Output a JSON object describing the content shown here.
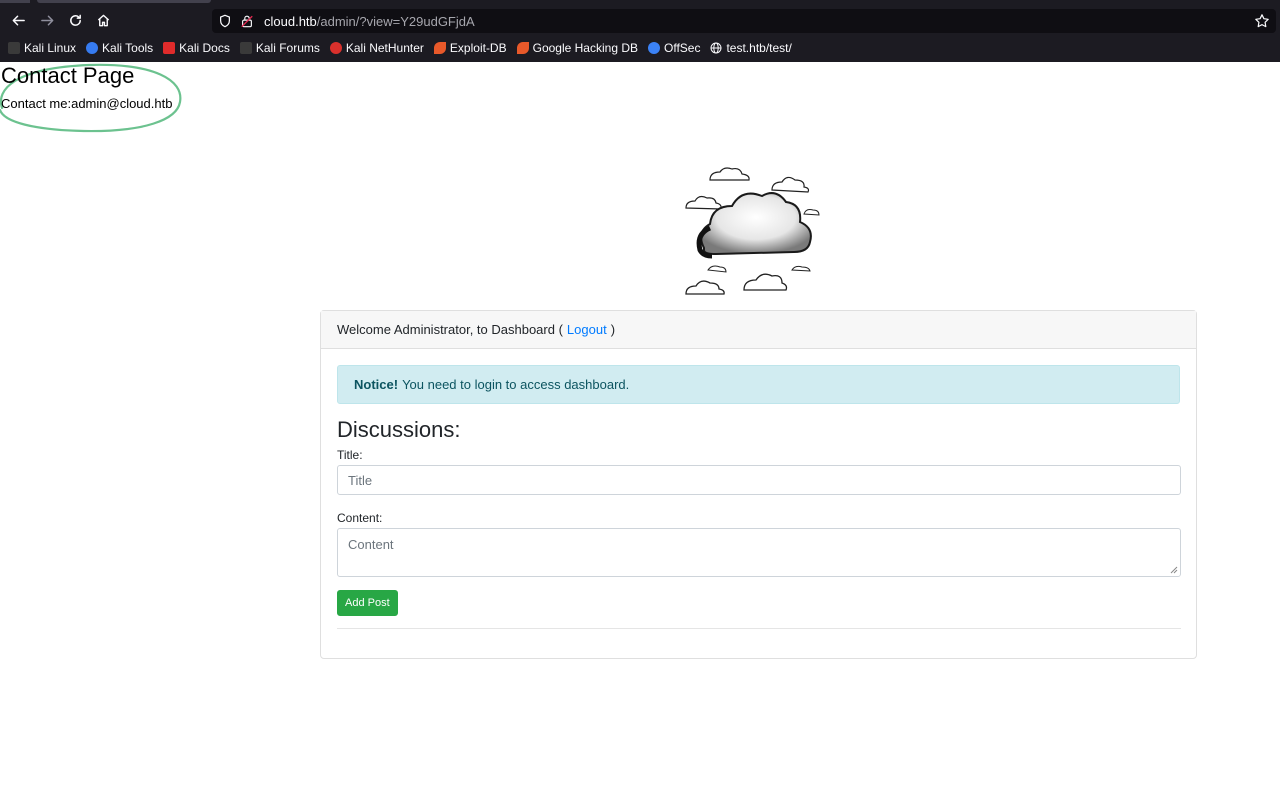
{
  "browser": {
    "url_host": "cloud.htb",
    "url_path": "/admin/?view=Y29udGFjdA",
    "bookmarks": [
      {
        "label": "Kali Linux",
        "icon": "kali-dragon-icon",
        "color": "#2f2f2f"
      },
      {
        "label": "Kali Tools",
        "icon": "kali-tools-icon",
        "color": "#367bf0"
      },
      {
        "label": "Kali Docs",
        "icon": "kali-docs-icon",
        "color": "#e02b2b"
      },
      {
        "label": "Kali Forums",
        "icon": "kali-dragon-icon",
        "color": "#2f2f2f"
      },
      {
        "label": "Kali NetHunter",
        "icon": "nethunter-icon",
        "color": "#d9302c"
      },
      {
        "label": "Exploit-DB",
        "icon": "exploitdb-icon",
        "color": "#e8592a"
      },
      {
        "label": "Google Hacking DB",
        "icon": "exploitdb-icon",
        "color": "#e8592a"
      },
      {
        "label": "OffSec",
        "icon": "offsec-icon",
        "color": "#3b82f6"
      },
      {
        "label": "test.htb/test/",
        "icon": "globe-icon",
        "color": "#fbfbfe"
      }
    ]
  },
  "contact": {
    "title": "Contact Page",
    "text": "Contact me:admin@cloud.htb",
    "highlight_color": "#6cc28f"
  },
  "dashboard": {
    "welcome_prefix": "Welcome Administrator, to Dashboard (",
    "logout_label": "Logout",
    "welcome_suffix": ")",
    "notice_bold": "Notice!",
    "notice_text": "You need to login to access dashboard.",
    "discussions_title": "Discussions:",
    "title_label": "Title:",
    "title_placeholder": "Title",
    "content_label": "Content:",
    "content_placeholder": "Content",
    "add_post_label": "Add Post"
  }
}
